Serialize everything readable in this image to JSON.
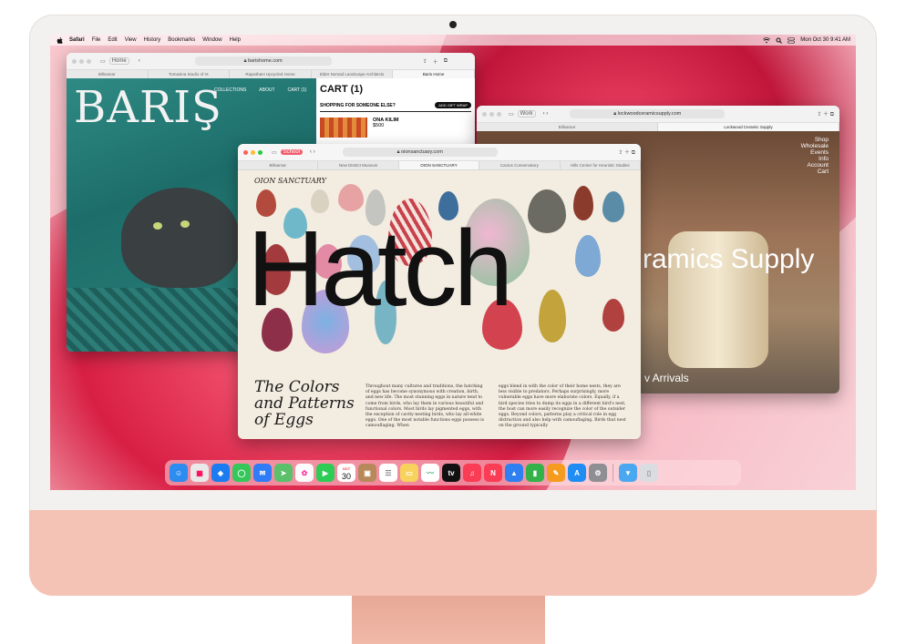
{
  "menubar": {
    "items": [
      "Safari",
      "File",
      "Edit",
      "View",
      "History",
      "Bookmarks",
      "Window",
      "Help"
    ],
    "datetime": "Mon Oct 30  9:41 AM"
  },
  "window_baris": {
    "sidebar_label": "Home",
    "url": "barishome.com",
    "tabs": [
      "Billsamar",
      "Tomasina Studio of IX",
      "Rajasthani Upcycled Home",
      "Elder Nomad Landscape Architects",
      "Baris Home"
    ],
    "brand": "BARIŞ",
    "nav": [
      "COLLECTIONS",
      "ABOUT",
      "CART (1)"
    ],
    "cart_title": "CART (1)",
    "cart_subtitle": "SHOPPING FOR SOMEONE ELSE?",
    "gift_button": "ADD GIFT WRAP",
    "product_name": "ONA KILIM",
    "product_price": "$500"
  },
  "window_ceramics": {
    "profile": "Work",
    "url": "lockwoodceramicsupply.com",
    "tabs": [
      "Billsamar",
      "Lockwood Ceramic Supply"
    ],
    "nav": [
      "Shop",
      "Wholesale",
      "Events",
      "Info",
      "Account",
      "Cart"
    ],
    "headline": "ramics Supply",
    "subhead": "v Arrivals"
  },
  "window_oion": {
    "profile": "School",
    "url": "oionsanctuary.com",
    "tabs": [
      "Billsamar",
      "New District Museum",
      "OION SANCTUARY",
      "Cactus Conservatory",
      "Hills Center for Heuristic Studies"
    ],
    "logo": "OION  SANCTUARY",
    "hero": "Hatch",
    "title_lines": [
      "The Colors",
      "and Patterns",
      "of Eggs"
    ],
    "col1": "Throughout many cultures and traditions, the hatching of eggs has become synonymous with creation, birth, and new life. The most stunning eggs in nature tend to come from birds, who lay them in various beautiful and functional colors. Most birds lay pigmented eggs, with the exception of cavity-nesting birds, who lay all-white eggs. One of the most notable functions eggs possess is camouflaging. When",
    "col2": "eggs blend in with the color of their home nests, they are less visible to predators. Perhaps surprisingly, more vulnerable eggs have more elaborate colors. Equally, if a bird species tries to dump its eggs in a different bird's nest, the host can more easily recognize the color of the outsider eggs. Beyond colors, patterns play a critical role in egg distraction and also help with camouflaging. Birds that nest on the ground typically"
  },
  "dock": {
    "calendar_month": "OCT",
    "calendar_day": "30",
    "tv_label": "tv",
    "apps": [
      {
        "name": "finder-icon",
        "color": "#2d8cf0"
      },
      {
        "name": "launchpad-icon",
        "color": "#e9e9e9"
      },
      {
        "name": "safari-icon",
        "color": "#1a7cf0"
      },
      {
        "name": "messages-icon",
        "color": "#34c759"
      },
      {
        "name": "mail-icon",
        "color": "#2f7cf6"
      },
      {
        "name": "maps-icon",
        "color": "#5ac06a"
      },
      {
        "name": "photos-icon",
        "color": "#fbfbfb"
      },
      {
        "name": "facetime-icon",
        "color": "#2ecc55"
      },
      {
        "name": "calendar-icon",
        "color": "#ffffff"
      },
      {
        "name": "contacts-icon",
        "color": "#b7895a"
      },
      {
        "name": "reminders-icon",
        "color": "#ffffff"
      },
      {
        "name": "notes-icon",
        "color": "#f7d25c"
      },
      {
        "name": "freeform-icon",
        "color": "#ffffff"
      },
      {
        "name": "tv-icon",
        "color": "#111111"
      },
      {
        "name": "music-icon",
        "color": "#fa3c55"
      },
      {
        "name": "news-icon",
        "color": "#fa3c55"
      },
      {
        "name": "keynote-icon",
        "color": "#2e7ff0"
      },
      {
        "name": "numbers-icon",
        "color": "#33b24a"
      },
      {
        "name": "pages-icon",
        "color": "#f59b1f"
      },
      {
        "name": "appstore-icon",
        "color": "#1f8df3"
      },
      {
        "name": "settings-icon",
        "color": "#8e8e93"
      },
      {
        "name": "downloads-icon",
        "color": "#4aa8f0"
      },
      {
        "name": "trash-icon",
        "color": "#d9dde2"
      }
    ]
  },
  "colors": {
    "imac_chin": "#f4c3b5",
    "wallpaper_accent": "#e53a5b"
  }
}
